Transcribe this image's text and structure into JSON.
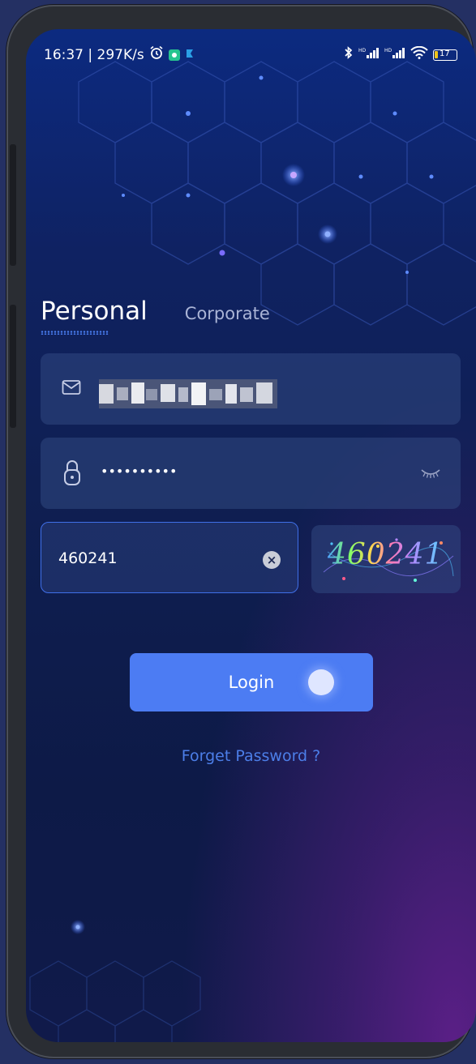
{
  "status_bar": {
    "time_speed": "16:37 | 297K/s",
    "icons": [
      "alarm-icon",
      "app-notification-icon",
      "cast-icon",
      "bluetooth-icon",
      "signal-hd-icon",
      "signal-hd-icon",
      "wifi-icon",
      "battery-icon"
    ],
    "battery": "17"
  },
  "tabs": {
    "personal": "Personal",
    "corporate": "Corporate",
    "active": "personal"
  },
  "form": {
    "email_icon": "mail-icon",
    "password_icon": "lock-icon",
    "password_value": "••••••••••",
    "password_toggle_icon": "eye-closed-icon",
    "code_value": "460241",
    "clear_icon": "clear-icon",
    "captcha_text": "460241"
  },
  "login_label": "Login",
  "forget_password": "Forget Password ?",
  "colors": {
    "accent": "#4c7cf3",
    "link": "#4c7ee8",
    "background": "#0f1f52"
  }
}
